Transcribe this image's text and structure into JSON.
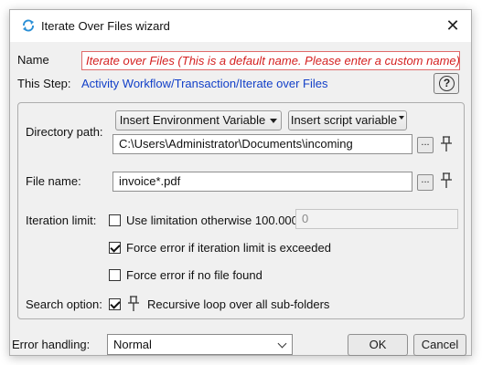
{
  "window": {
    "title": "Iterate Over Files wizard",
    "title_icon": "iterate-arrows-icon",
    "close_glyph": "✕"
  },
  "name_row": {
    "label": "Name",
    "value": "Iterate over Files  (This is a default name. Please enter a custom name)"
  },
  "step_row": {
    "label": "This Step:",
    "link": "Activity Workflow/Transaction/Iterate over Files",
    "help_glyph": "?"
  },
  "directory": {
    "label": "Directory path:",
    "env_button": "Insert Environment Variable",
    "script_button": "Insert script variable",
    "value": "C:\\Users\\Administrator\\Documents\\incoming",
    "browse": "..."
  },
  "file": {
    "label": "File name:",
    "value": "invoice*.pdf",
    "browse": "..."
  },
  "iteration": {
    "label": "Iteration limit:",
    "use_limitation": {
      "label": "Use limitation otherwise 100.000",
      "checked": false
    },
    "limit_value": "0",
    "force_error_exceeded": {
      "label": "Force error if iteration limit is exceeded",
      "checked": true
    },
    "force_error_no_file": {
      "label": "Force error if no file found",
      "checked": false
    }
  },
  "search": {
    "label": "Search option:",
    "recursive": {
      "label": "Recursive loop over all sub-folders",
      "checked": true
    }
  },
  "footer": {
    "error_label": "Error handling:",
    "error_value": "Normal",
    "ok": "OK",
    "cancel": "Cancel"
  },
  "colors": {
    "link": "#1340c8",
    "default_name_text": "#d42020",
    "default_name_border": "#e06a6a",
    "title_icon": "#2a8fd6"
  }
}
